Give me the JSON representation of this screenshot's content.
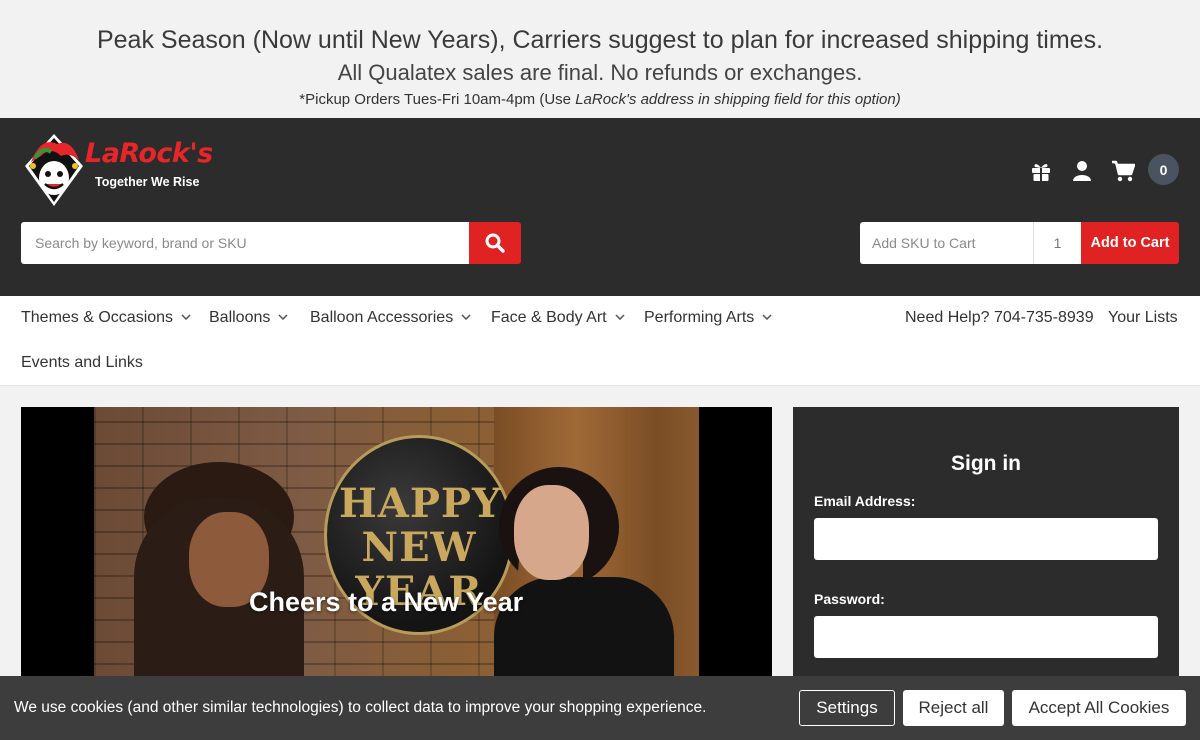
{
  "announcement": {
    "line1": "Peak Season (Now until New Years), Carriers suggest to plan for increased shipping times.",
    "line2": "All Qualatex sales are final. No refunds or exchanges.",
    "line3_prefix": "*Pickup Orders  Tues-Fri 10am-4pm (Use ",
    "line3_italic": "LaRock's address in shipping field for this option)"
  },
  "header": {
    "brand": "LaRock's",
    "tagline": "Together We Rise",
    "icons": [
      "gift-icon",
      "user-icon",
      "cart-icon"
    ],
    "cart_count": "0",
    "search_placeholder": "Search by keyword, brand or SKU",
    "sku_placeholder": "Add SKU to Cart",
    "qty_value": "1",
    "add_to_cart": "Add to Cart"
  },
  "nav": {
    "items": [
      {
        "label": "Themes & Occasions"
      },
      {
        "label": "Balloons"
      },
      {
        "label": "Balloon Accessories"
      },
      {
        "label": "Face & Body Art"
      },
      {
        "label": "Performing Arts"
      },
      {
        "label": "Events and Links"
      }
    ],
    "help": "Need Help? 704-735-8939",
    "lists": "Your Lists"
  },
  "hero": {
    "caption": "Cheers to a New Year",
    "balloon_text": "HAPPY NEW YEAR"
  },
  "signin": {
    "title": "Sign in",
    "email_label": "Email Address:",
    "password_label": "Password:"
  },
  "cookie": {
    "message": "We use cookies (and other similar technologies) to collect data to improve your shopping experience.",
    "settings": "Settings",
    "reject": "Reject all",
    "accept": "Accept All Cookies"
  },
  "colors": {
    "accent": "#e02222",
    "header_bg": "#2c2c2c",
    "cart_badge": "#4a5360"
  }
}
